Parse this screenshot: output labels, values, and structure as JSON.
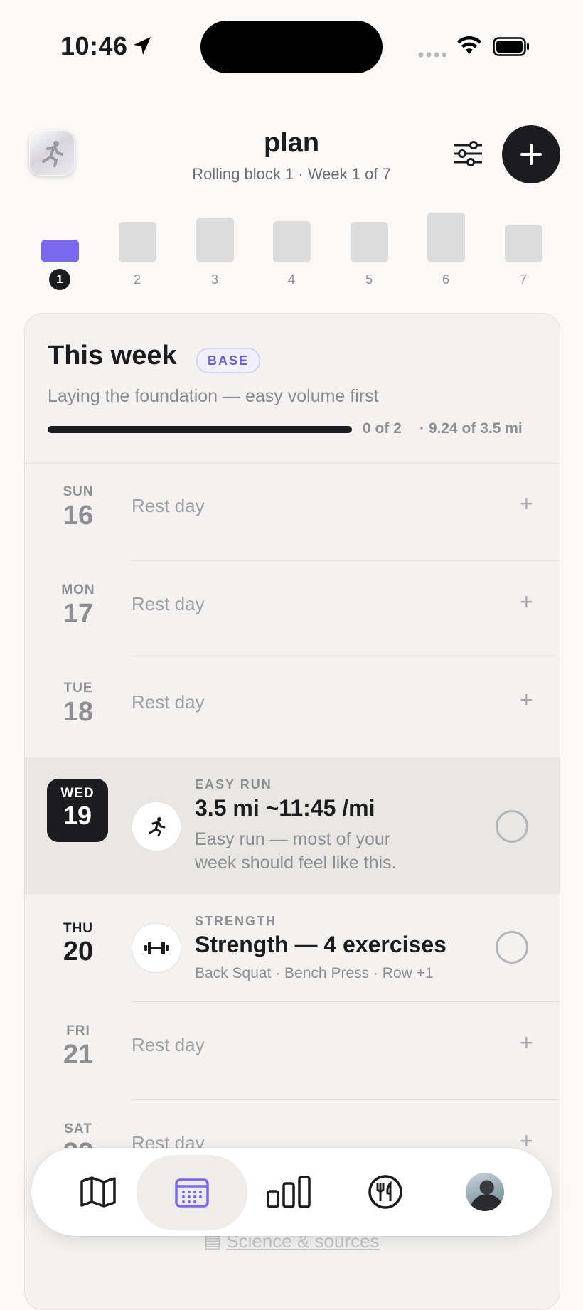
{
  "status_bar": {
    "time": "10:46"
  },
  "header": {
    "title": "plan",
    "subtitle": "Rolling block 1 · Week 1 of 7"
  },
  "weeks": [
    {
      "label": "1",
      "active": true,
      "volume": 0.45
    },
    {
      "label": "2",
      "active": false,
      "volume": 0.82
    },
    {
      "label": "3",
      "active": false,
      "volume": 0.9
    },
    {
      "label": "4",
      "active": false,
      "volume": 0.83
    },
    {
      "label": "5",
      "active": false,
      "volume": 0.81
    },
    {
      "label": "6",
      "active": false,
      "volume": 1.0
    },
    {
      "label": "7",
      "active": false,
      "volume": 0.76
    }
  ],
  "this_week": {
    "title": "This week",
    "phase": "BASE",
    "description": "Laying the foundation — easy volume first",
    "progress_count": "0 of 2",
    "progress_miles": "· 9.24 of 3.5 mi",
    "progress_fraction": 1.0
  },
  "days": [
    {
      "dow": "SUN",
      "num": "16",
      "text": "Rest day"
    },
    {
      "dow": "MON",
      "num": "17",
      "text": "Rest day"
    },
    {
      "dow": "TUE",
      "num": "18",
      "text": "Rest day"
    },
    {
      "dow": "WED",
      "num": "19",
      "kind": "EASY RUN",
      "title": "3.5 mi ~11:45 /mi",
      "desc": "Easy run — most of your week should feel like this.",
      "icon": "runner-icon"
    },
    {
      "dow": "THU",
      "num": "20",
      "kind": "STRENGTH",
      "title": "Strength — 4 exercises",
      "desc": "Back Squat · Bench Press · Row +1",
      "icon": "dumbbell-icon"
    },
    {
      "dow": "FRI",
      "num": "21",
      "text": "Rest day"
    },
    {
      "dow": "SAT",
      "num": "22",
      "text": "Rest day"
    }
  ],
  "footer": {
    "sources_link": "Science & sources"
  },
  "tabbar": {
    "tabs": [
      "map-icon",
      "calendar-icon",
      "stats-icon",
      "nutrition-icon",
      "profile-avatar"
    ],
    "active": "calendar-icon"
  },
  "colors": {
    "accent": "#7b68ee",
    "dark": "#1c1c1e",
    "card": "#f3f2f0"
  }
}
